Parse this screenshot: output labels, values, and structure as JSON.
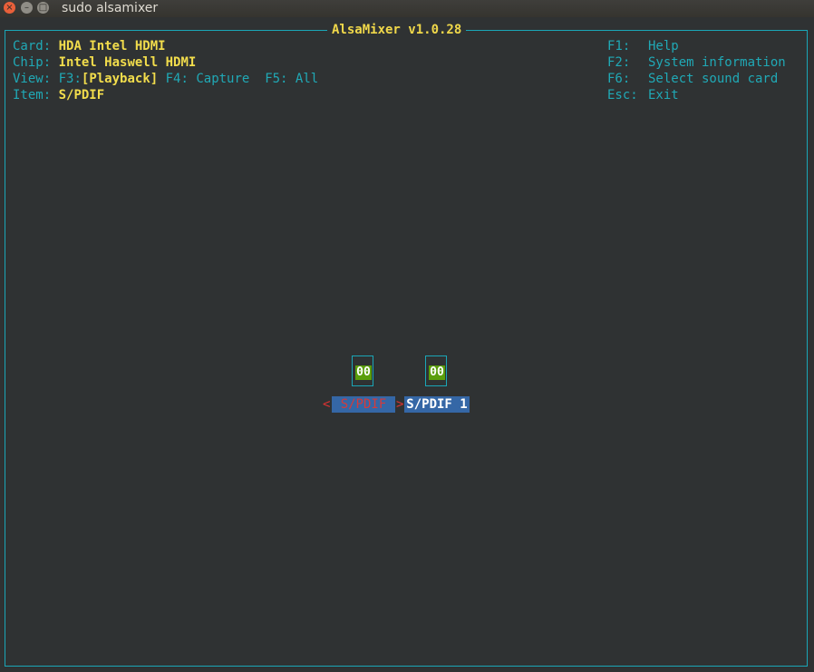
{
  "window": {
    "title": "sudo alsamixer",
    "buttons": {
      "close": "×",
      "minimize": "–",
      "maximize": "□"
    }
  },
  "app": {
    "title": "AlsaMixer v1.0.28"
  },
  "info": {
    "card_label": "Card:",
    "card_value": "HDA Intel HDMI",
    "chip_label": "Chip:",
    "chip_value": "Intel Haswell HDMI",
    "view_label": "View:",
    "view_f3_key": "F3:",
    "view_f3_value": "[Playback]",
    "view_f4": "F4: Capture",
    "view_f5": "F5: All",
    "item_label": "Item:",
    "item_value": "S/PDIF"
  },
  "help": [
    {
      "key": "F1:",
      "label": "Help"
    },
    {
      "key": "F2:",
      "label": "System information"
    },
    {
      "key": "F6:",
      "label": "Select sound card"
    },
    {
      "key": "Esc:",
      "label": "Exit"
    }
  ],
  "controls": [
    {
      "state": "00",
      "name": "S/PDIF",
      "selected": true
    },
    {
      "state": "00",
      "name": "S/PDIF 1",
      "selected": false
    }
  ],
  "selection_arrows": {
    "left": "<",
    "right": ">"
  },
  "colors": {
    "border": "#1aa6b7",
    "label": "#20a9b6",
    "value": "#f2dd4c",
    "mute_bg": "#5a9e0c",
    "name_bg": "#3567a6",
    "selected_name": "#d63a3a"
  }
}
